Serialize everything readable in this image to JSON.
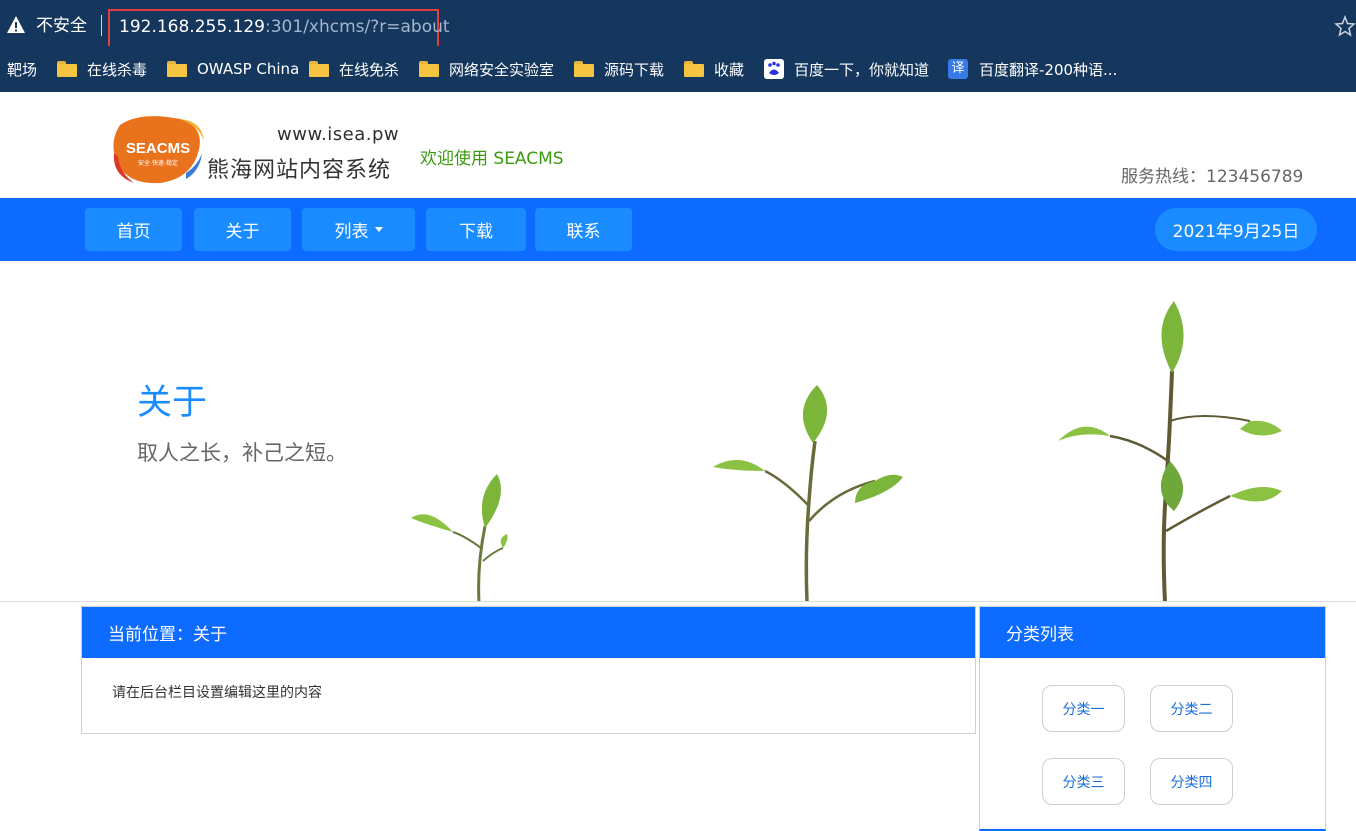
{
  "browser": {
    "security_label": "不安全",
    "url_host": "192.168.255.129",
    "url_rest": ":301/xhcms/?r=about",
    "bookmarks": [
      {
        "label": "靶场",
        "icon": "none"
      },
      {
        "label": "在线杀毒",
        "icon": "folder-icon"
      },
      {
        "label": "OWASP China",
        "icon": "folder-icon"
      },
      {
        "label": "在线免杀",
        "icon": "folder-icon"
      },
      {
        "label": "网络安全实验室",
        "icon": "folder-icon"
      },
      {
        "label": "源码下载",
        "icon": "folder-icon"
      },
      {
        "label": "收藏",
        "icon": "folder-icon"
      },
      {
        "label": "百度一下，你就知道",
        "icon": "baidu-icon"
      },
      {
        "label": "百度翻译-200种语...",
        "icon": "translate-icon"
      }
    ],
    "translate_icon_glyph": "译"
  },
  "header": {
    "logo_text": "SEACMS",
    "logo_tagline": "安全·快速·稳定",
    "logo_url": "www.isea.pw",
    "logo_name": "熊海网站内容系统",
    "welcome": "欢迎使用 SEACMS",
    "hotline": "服务热线：123456789"
  },
  "nav": {
    "items": [
      {
        "label": "首页"
      },
      {
        "label": "关于"
      },
      {
        "label": "列表"
      },
      {
        "label": "下载"
      },
      {
        "label": "联系"
      }
    ],
    "date": "2021年9月25日"
  },
  "banner": {
    "title": "关于",
    "subtitle": "取人之长，补己之短。"
  },
  "main": {
    "breadcrumb": "当前位置：关于",
    "content": "请在后台栏目设置编辑这里的内容"
  },
  "sidebar": {
    "title": "分类列表",
    "categories": [
      {
        "label": "分类一"
      },
      {
        "label": "分类二"
      },
      {
        "label": "分类三"
      },
      {
        "label": "分类四"
      }
    ]
  },
  "colors": {
    "chrome_bg": "#15375e",
    "nav_blue": "#0d6cff",
    "button_blue": "#1a8cff",
    "welcome_green": "#3c9a12",
    "url_highlight": "#e2403c"
  }
}
